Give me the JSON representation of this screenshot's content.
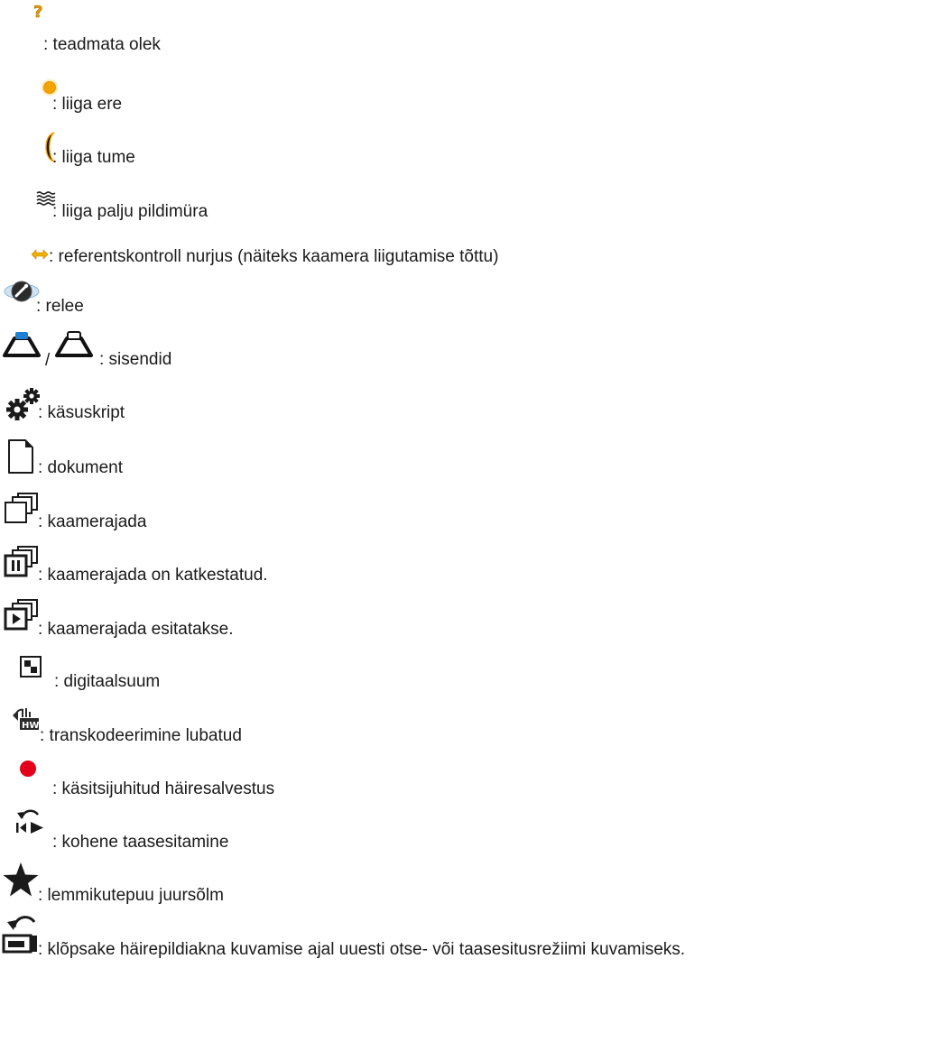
{
  "items": [
    {
      "icon": "unknown-state-icon",
      "text": ": teadmata olek"
    },
    {
      "icon": "too-bright-icon",
      "text": ": liiga ere"
    },
    {
      "icon": "too-dark-icon",
      "text": ": liiga tume"
    },
    {
      "icon": "too-noisy-icon",
      "text": ": liiga palju pildimüra"
    },
    {
      "icon": "reference-check-failed-icon",
      "text": ": referentskontroll nurjus (näiteks kaamera liigutamise tõttu)"
    },
    {
      "icon": "relay-icon",
      "text": ": relee"
    },
    {
      "icon": "input-active-icon",
      "icon2": "input-inactive-icon",
      "sep": "/",
      "text": ": sisendid"
    },
    {
      "icon": "command-script-icon",
      "text": ": käsuskript"
    },
    {
      "icon": "document-icon",
      "text": ": dokument"
    },
    {
      "icon": "camera-sequence-icon",
      "text": ": kaamerajada"
    },
    {
      "icon": "camera-sequence-paused-icon",
      "text": ": kaamerajada on katkestatud."
    },
    {
      "icon": "camera-sequence-playing-icon",
      "text": ": kaamerajada esitatakse."
    },
    {
      "icon": "digital-zoom-icon",
      "text": ": digitaalsuum"
    },
    {
      "icon": "transcoding-icon",
      "text": ": transkodeerimine lubatud"
    },
    {
      "icon": "manual-alarm-recording-icon",
      "text": ": käsitsijuhitud häiresalvestus"
    },
    {
      "icon": "instant-playback-icon",
      "text": ": kohene taasesitamine"
    },
    {
      "icon": "favorites-root-icon",
      "text": ": lemmikutepuu juursõlm"
    },
    {
      "icon": "return-to-live-icon",
      "text": ": klõpsake häirepildiakna kuvamise ajal uuesti otse- või taasesitusrežiimi kuvamiseks."
    }
  ],
  "colors": {
    "text": "#1a1a1a",
    "orange": "#f0a000",
    "record_red": "#e2001a",
    "relay_blue": "#3b8fd0",
    "input_blue": "#1f7fd0"
  }
}
